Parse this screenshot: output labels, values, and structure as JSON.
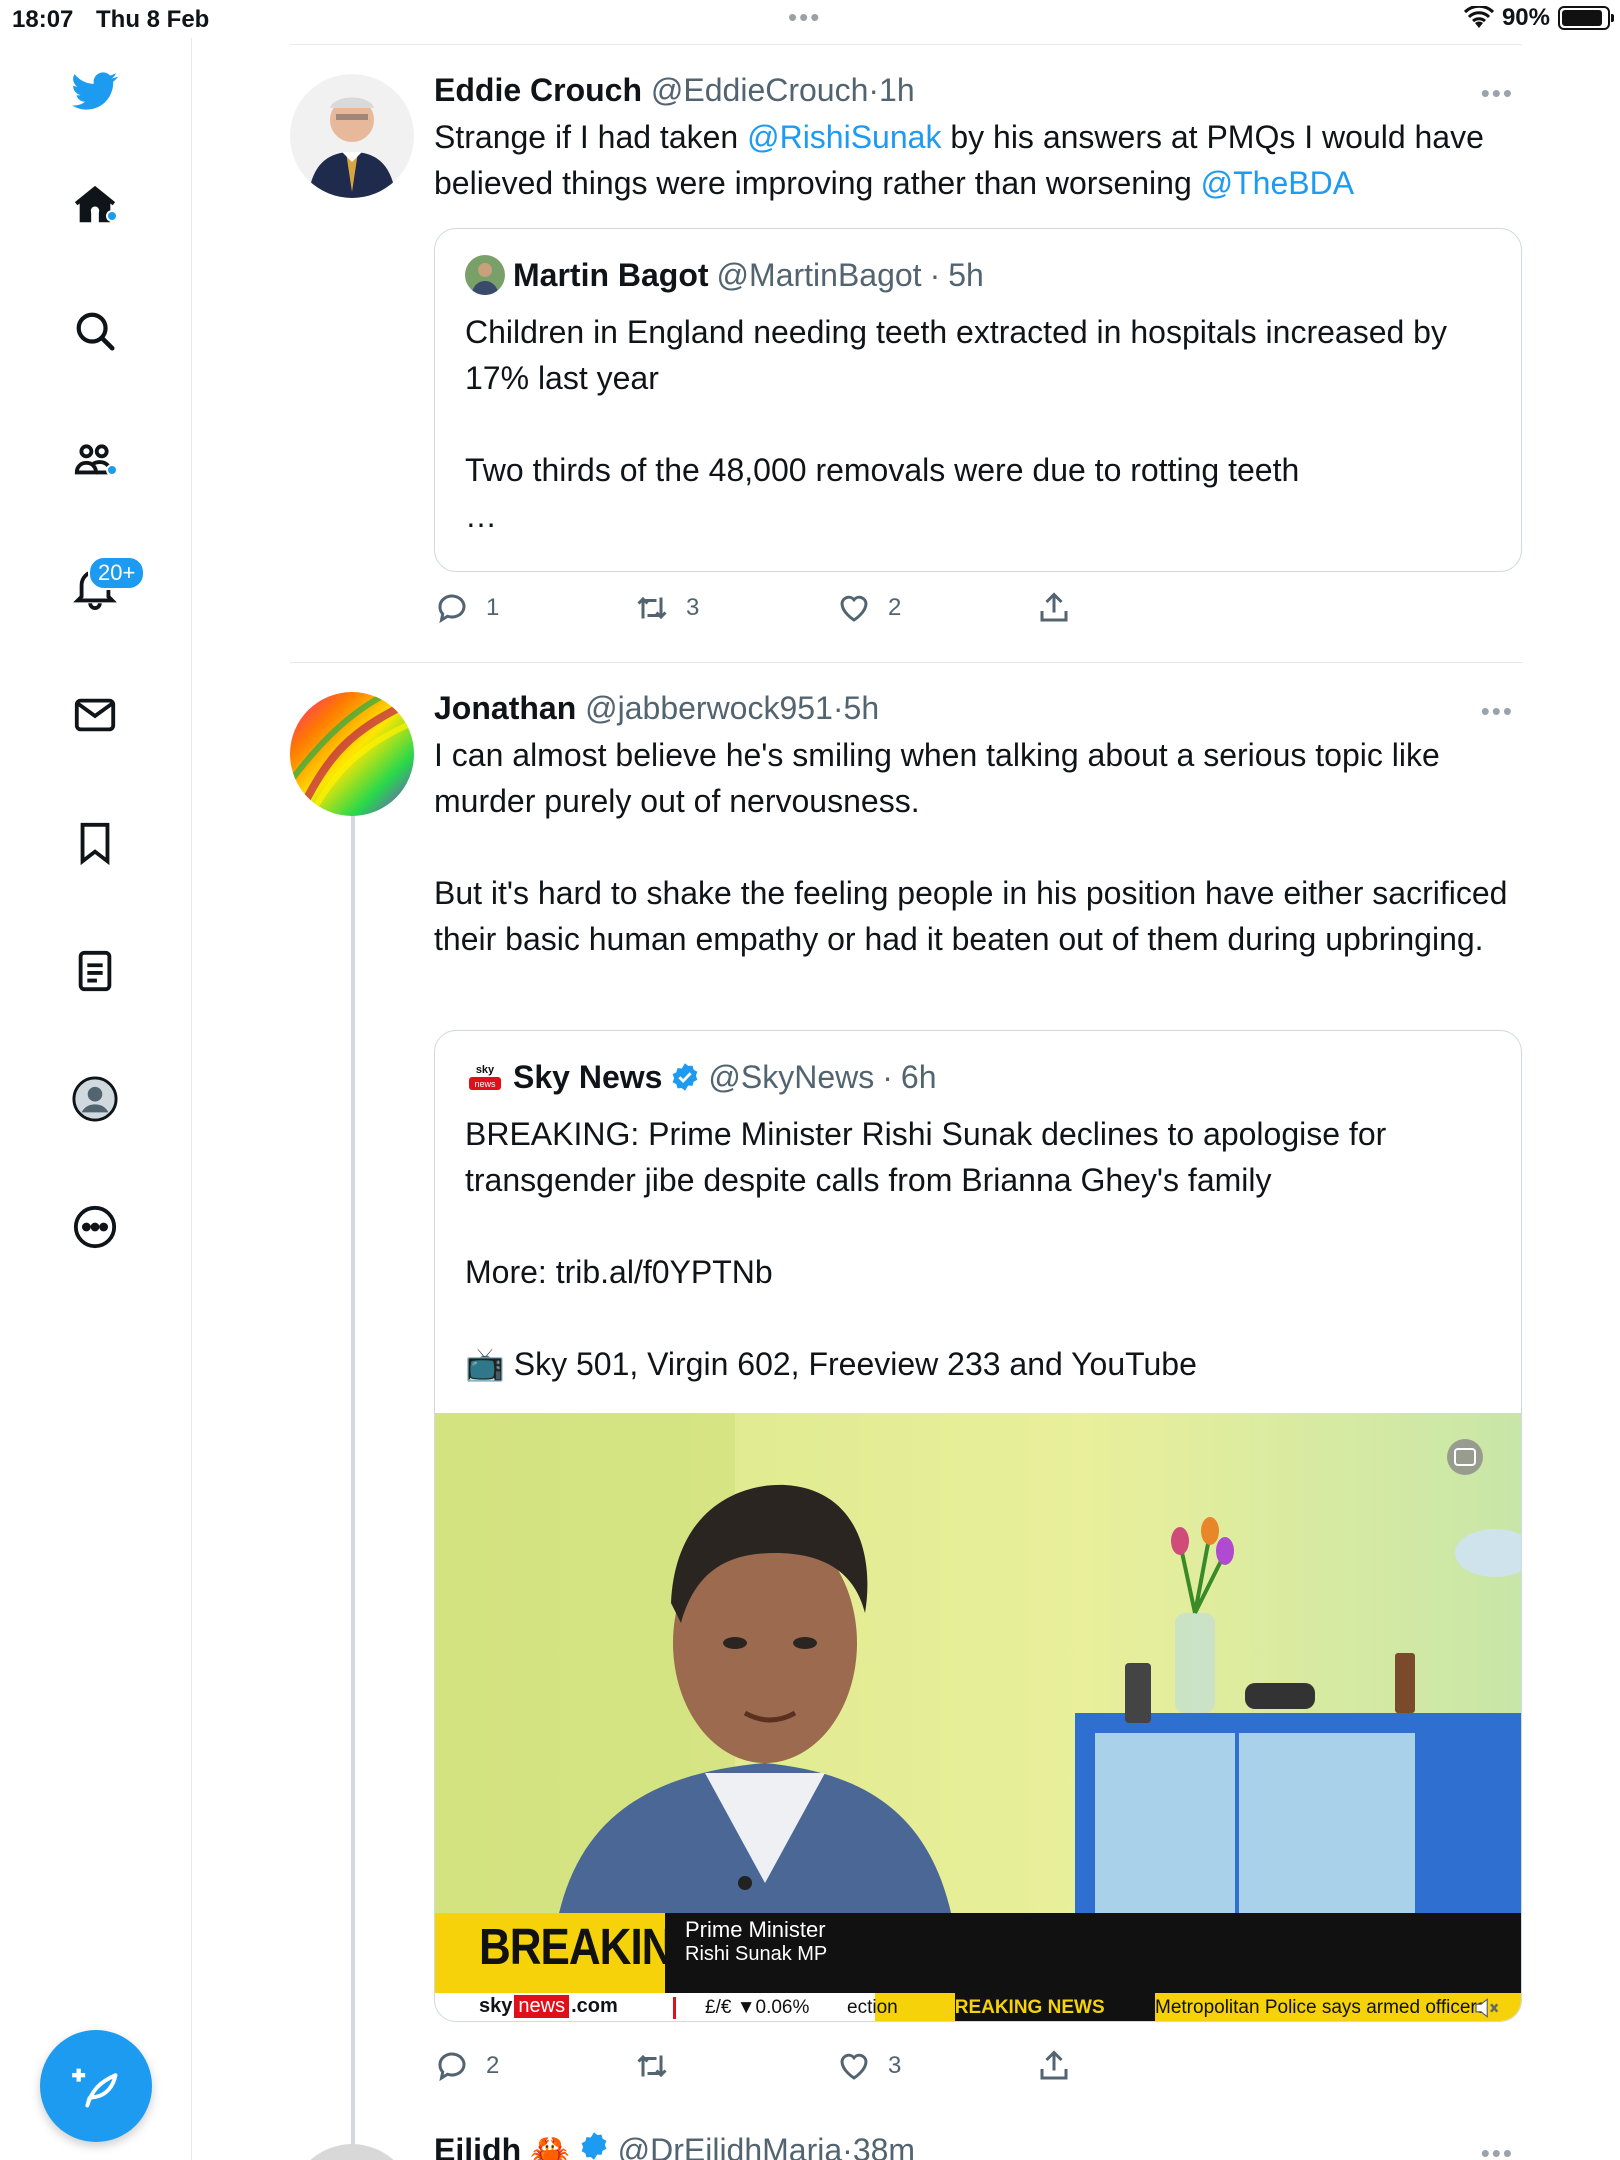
{
  "status_bar": {
    "time": "18:07",
    "date": "Thu 8 Feb",
    "battery": "90%"
  },
  "sidebar": {
    "notifications_badge": "20+",
    "icons": [
      "twitter-bird-icon",
      "home-icon",
      "search-icon",
      "communities-icon",
      "notifications-icon",
      "messages-icon",
      "bookmarks-icon",
      "lists-icon",
      "profile-icon",
      "more-icon"
    ],
    "accent": "#1d9bf0"
  },
  "tweets": [
    {
      "name": "Eddie Crouch",
      "handle": "@EddieCrouch",
      "sep": "·",
      "time": "1h",
      "text_pre": "Strange if I had taken ",
      "mention1": "@RishiSunak",
      "text_mid": " by his answers at PMQs I would have believed things were improving rather than worsening ",
      "mention2": "@TheBDA",
      "quote": {
        "name": "Martin Bagot",
        "handle": "@MartinBagot",
        "sep": "·",
        "time": "5h",
        "text": "Children in England needing teeth extracted in hospitals increased by 17% last year\n\nTwo thirds of the 48,000 removals were due to rotting teeth\n…"
      },
      "replies": "1",
      "retweets": "3",
      "likes": "2"
    },
    {
      "name": "Jonathan",
      "handle": "@jabberwock951",
      "sep": "·",
      "time": "5h",
      "text": "I can almost believe he's smiling when talking about a  serious topic like murder purely out of nervousness.\n\nBut it's hard to shake the feeling people in his position have either sacrificed their basic human empathy or had it beaten out of them during upbringing.",
      "quote": {
        "name": "Sky News",
        "handle": "@SkyNews",
        "sep": "·",
        "time": "6h",
        "text": "BREAKING: Prime Minister Rishi Sunak declines to apologise for transgender jibe despite calls from Brianna Ghey's family\n\nMore: trib.al/f0YPTNb\n\n📺 Sky 501, Virgin 602, Freeview 233 and YouTube",
        "media": {
          "breaking_label": "BREAKING NEWS",
          "caption_title": "Prime Minister",
          "caption_sub": "Rishi Sunak MP",
          "ticker_brand_sky": "sky",
          "ticker_brand_news": "news",
          "ticker_brand_com": ".com",
          "ticker_fx": "£/€ ▼0.06%",
          "ticker_section": "ection",
          "ticker_breaking": "BREAKING NEWS",
          "ticker_headline": "Metropolitan Police says armed officers"
        }
      },
      "replies": "2",
      "retweets": "",
      "likes": "3"
    },
    {
      "name": "Eilidh",
      "emoji": "🦀",
      "handle": "@DrEilidhMaria",
      "sep": "·",
      "time": "38m"
    }
  ]
}
